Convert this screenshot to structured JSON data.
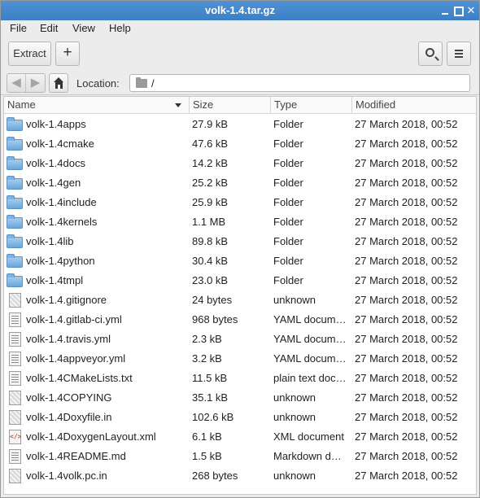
{
  "window": {
    "title": "volk-1.4.tar.gz"
  },
  "menu": {
    "file": "File",
    "edit": "Edit",
    "view": "View",
    "help": "Help"
  },
  "toolbar": {
    "extract_label": "Extract",
    "add_label": "+"
  },
  "location": {
    "label": "Location:",
    "value": "/"
  },
  "columns": {
    "name": "Name",
    "size": "Size",
    "type": "Type",
    "modified": "Modified"
  },
  "files": [
    {
      "name": "volk-1.4apps",
      "size": "27.9 kB",
      "type": "Folder",
      "modified": "27 March 2018, 00:52",
      "icon": "folder-icon"
    },
    {
      "name": "volk-1.4cmake",
      "size": "47.6 kB",
      "type": "Folder",
      "modified": "27 March 2018, 00:52",
      "icon": "folder-icon"
    },
    {
      "name": "volk-1.4docs",
      "size": "14.2 kB",
      "type": "Folder",
      "modified": "27 March 2018, 00:52",
      "icon": "folder-icon"
    },
    {
      "name": "volk-1.4gen",
      "size": "25.2 kB",
      "type": "Folder",
      "modified": "27 March 2018, 00:52",
      "icon": "folder-icon"
    },
    {
      "name": "volk-1.4include",
      "size": "25.9 kB",
      "type": "Folder",
      "modified": "27 March 2018, 00:52",
      "icon": "folder-icon"
    },
    {
      "name": "volk-1.4kernels",
      "size": "1.1 MB",
      "type": "Folder",
      "modified": "27 March 2018, 00:52",
      "icon": "folder-icon"
    },
    {
      "name": "volk-1.4lib",
      "size": "89.8 kB",
      "type": "Folder",
      "modified": "27 March 2018, 00:52",
      "icon": "folder-icon"
    },
    {
      "name": "volk-1.4python",
      "size": "30.4 kB",
      "type": "Folder",
      "modified": "27 March 2018, 00:52",
      "icon": "folder-icon"
    },
    {
      "name": "volk-1.4tmpl",
      "size": "23.0 kB",
      "type": "Folder",
      "modified": "27 March 2018, 00:52",
      "icon": "folder-icon"
    },
    {
      "name": "volk-1.4.gitignore",
      "size": "24 bytes",
      "type": "unknown",
      "modified": "27 March 2018, 00:52",
      "icon": "unknown-file-icon"
    },
    {
      "name": "volk-1.4.gitlab-ci.yml",
      "size": "968 bytes",
      "type": "YAML docum…",
      "modified": "27 March 2018, 00:52",
      "icon": "text-file-icon"
    },
    {
      "name": "volk-1.4.travis.yml",
      "size": "2.3 kB",
      "type": "YAML docum…",
      "modified": "27 March 2018, 00:52",
      "icon": "text-file-icon"
    },
    {
      "name": "volk-1.4appveyor.yml",
      "size": "3.2 kB",
      "type": "YAML docum…",
      "modified": "27 March 2018, 00:52",
      "icon": "text-file-icon"
    },
    {
      "name": "volk-1.4CMakeLists.txt",
      "size": "11.5 kB",
      "type": "plain text doc…",
      "modified": "27 March 2018, 00:52",
      "icon": "text-file-icon"
    },
    {
      "name": "volk-1.4COPYING",
      "size": "35.1 kB",
      "type": "unknown",
      "modified": "27 March 2018, 00:52",
      "icon": "unknown-file-icon"
    },
    {
      "name": "volk-1.4Doxyfile.in",
      "size": "102.6 kB",
      "type": "unknown",
      "modified": "27 March 2018, 00:52",
      "icon": "unknown-file-icon"
    },
    {
      "name": "volk-1.4DoxygenLayout.xml",
      "size": "6.1 kB",
      "type": "XML document",
      "modified": "27 March 2018, 00:52",
      "icon": "xml-file-icon"
    },
    {
      "name": "volk-1.4README.md",
      "size": "1.5 kB",
      "type": "Markdown d…",
      "modified": "27 March 2018, 00:52",
      "icon": "text-file-icon"
    },
    {
      "name": "volk-1.4volk.pc.in",
      "size": "268 bytes",
      "type": "unknown",
      "modified": "27 March 2018, 00:52",
      "icon": "unknown-file-icon"
    }
  ]
}
